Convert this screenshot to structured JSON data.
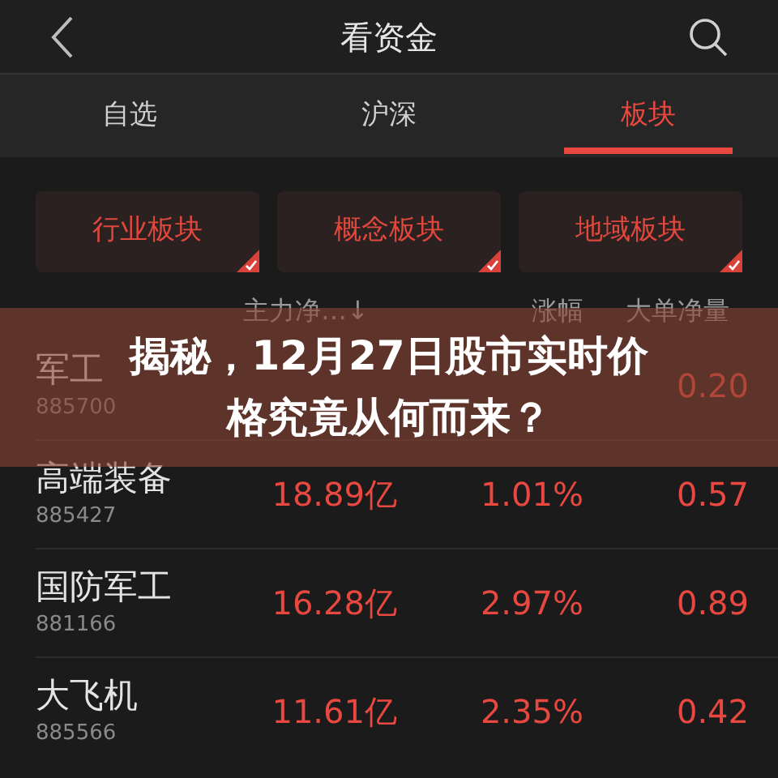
{
  "top_bar": {
    "title": "看资金"
  },
  "tabs": [
    {
      "label": "自选",
      "selected": false
    },
    {
      "label": "沪深",
      "selected": false
    },
    {
      "label": "板块",
      "selected": true
    }
  ],
  "chips": [
    {
      "label": "行业板块",
      "checked": true
    },
    {
      "label": "概念板块",
      "checked": true
    },
    {
      "label": "地域板块",
      "checked": true
    }
  ],
  "table": {
    "columns": [
      "主力净…↓",
      "涨幅",
      "大单净量"
    ],
    "rows": [
      {
        "name": "军工",
        "code": "885700",
        "large_order": "0.20"
      },
      {
        "name": "高端装备",
        "code": "885427",
        "net_inflow": "18.89亿",
        "change": "1.01%",
        "large_order": "0.57"
      },
      {
        "name": "国防军工",
        "code": "881166",
        "net_inflow": "16.28亿",
        "change": "2.97%",
        "large_order": "0.89"
      },
      {
        "name": "大飞机",
        "code": "885566",
        "net_inflow": "11.61亿",
        "change": "2.35%",
        "large_order": "0.42"
      }
    ]
  },
  "banner": {
    "lines": [
      "揭秘，12月27日股市实时价",
      "格究竟从何而来？"
    ]
  }
}
